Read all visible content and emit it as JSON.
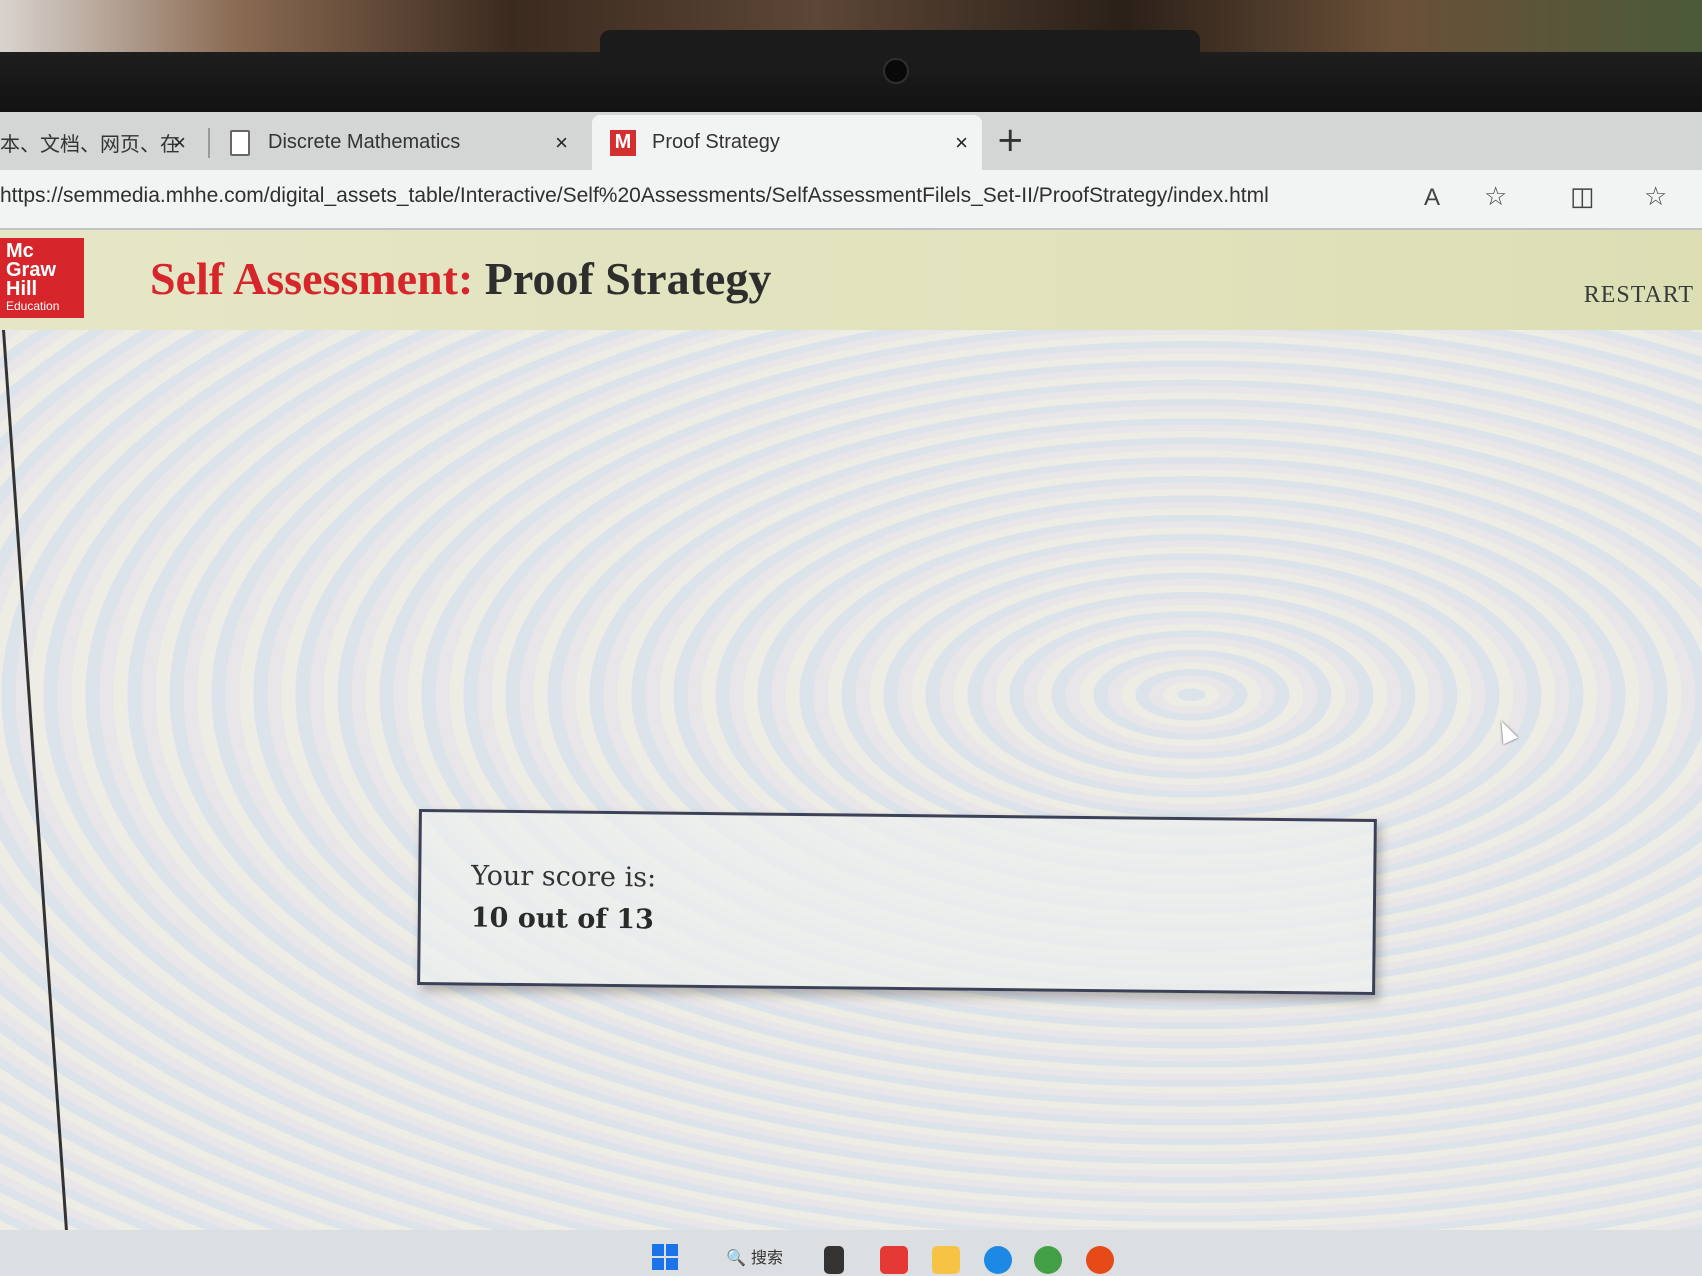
{
  "browser": {
    "tabs": [
      {
        "label": "本、文档、网页、在",
        "close": "×",
        "icon": "none"
      },
      {
        "label": "Discrete Mathematics",
        "close": "×",
        "icon": "page-icon"
      },
      {
        "label": "Proof Strategy",
        "close": "×",
        "icon": "mcgraw-hill-favicon",
        "favicon_text": "M",
        "active": true
      }
    ],
    "new_tab": "+",
    "url": "https://semmedia.mhhe.com/digital_assets_table/Interactive/Self%20Assessments/SelfAssessmentFilels_Set-II/ProofStrategy/index.html",
    "toolbar_icons": {
      "read_aloud": "A",
      "add_favorite": "☆",
      "split_screen": "◫",
      "favorites": "☆"
    }
  },
  "header": {
    "logo": {
      "line1": "Mc",
      "line2": "Graw",
      "line3": "Hill",
      "line4": "Education"
    },
    "title_prefix": "Self Assessment:",
    "title_name": "Proof Strategy",
    "restart_label": "RESTART"
  },
  "result": {
    "label": "Your score is:",
    "value": "10 out of 13"
  },
  "taskbar": {
    "search_label": "搜索",
    "search_icon": "🔍"
  },
  "colors": {
    "brand_red": "#d7262b",
    "header_bg": "#e2e4bf",
    "box_border": "#3c4158"
  }
}
